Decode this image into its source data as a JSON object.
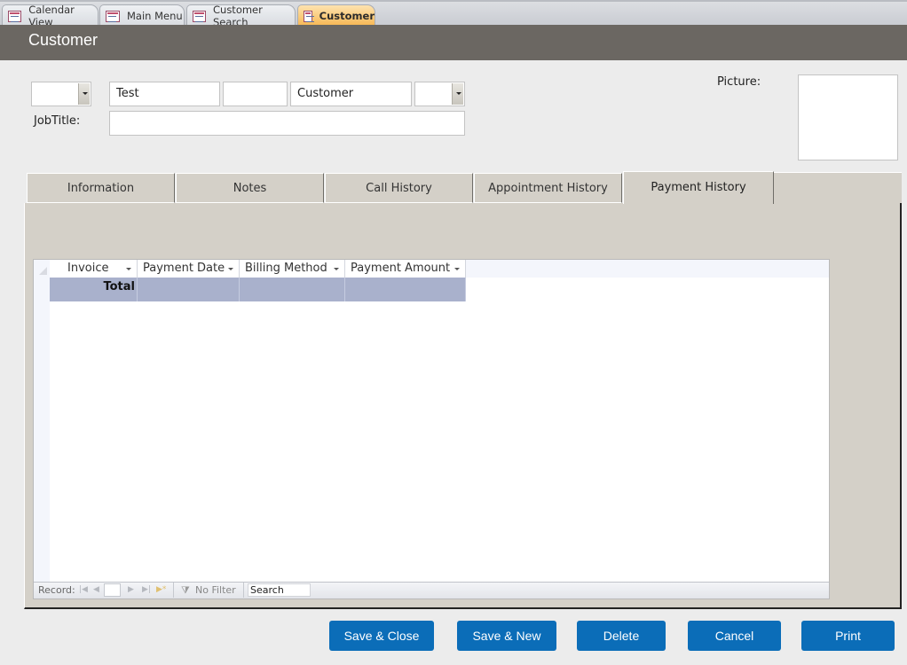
{
  "document_tabs": [
    {
      "label": "Calendar View",
      "icon": "form-icon",
      "active": false
    },
    {
      "label": "Main Menu",
      "icon": "form-icon",
      "active": false
    },
    {
      "label": "Customer Search",
      "icon": "form-icon",
      "active": false
    },
    {
      "label": "Customer",
      "icon": "form-icon",
      "active": true
    }
  ],
  "header": {
    "title": "Customer"
  },
  "fields": {
    "title_combo": {
      "value": ""
    },
    "first_name": {
      "value": "Test"
    },
    "middle_name": {
      "value": ""
    },
    "last_name": {
      "value": "Customer"
    },
    "suffix_combo": {
      "value": ""
    },
    "job_title_label": "JobTitle:",
    "job_title": {
      "value": ""
    },
    "picture_label": "Picture:"
  },
  "page_tabs": [
    {
      "label": "Information",
      "active": false
    },
    {
      "label": "Notes",
      "active": false
    },
    {
      "label": "Call History",
      "active": false
    },
    {
      "label": "Appointment History",
      "active": false
    },
    {
      "label": "Payment History",
      "active": true
    }
  ],
  "datasheet": {
    "columns": [
      "Invoice",
      "Payment Date",
      "Billing Method",
      "Payment Amount"
    ],
    "rows": [],
    "total_row": {
      "label": "Total",
      "values": [
        "",
        "",
        ""
      ]
    },
    "navigation": {
      "record_label": "Record:",
      "current_record": "",
      "filter_label": "No Filter",
      "search_placeholder": "Search"
    }
  },
  "buttons": {
    "save_close": "Save & Close",
    "save_new": "Save & New",
    "delete": "Delete",
    "cancel": "Cancel",
    "print": "Print"
  },
  "colors": {
    "header_bg": "#6b6762",
    "active_tab": "#f7b650",
    "button_bg": "#0b6db8",
    "total_row_bg": "#a9b1cc",
    "tab_control_bg": "#d4d0c8"
  }
}
